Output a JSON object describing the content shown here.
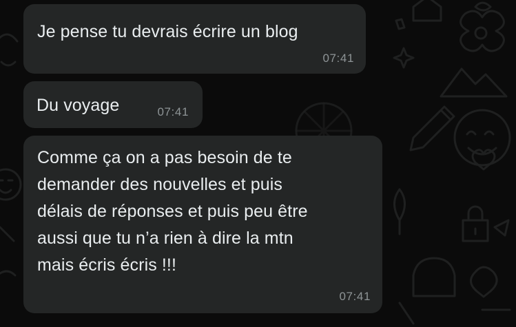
{
  "messages": [
    {
      "text": "Je pense tu devrais écrire un blog",
      "time": "07:41"
    },
    {
      "text": "Du voyage",
      "time": "07:41"
    },
    {
      "text": "Comme ça on a pas besoin de te\ndemander des nouvelles et puis\ndélais de réponses et puis peu être\naussi que tu n’a rien à dire la mtn\nmais écris écris !!!",
      "time": "07:41"
    }
  ],
  "colors": {
    "background": "#0b0b0b",
    "bubble": "#242626",
    "text": "#e9edef",
    "timestamp": "#8e9496",
    "doodle": "#1e1f1f"
  }
}
